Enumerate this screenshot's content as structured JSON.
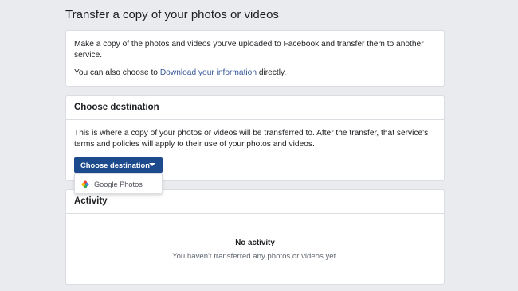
{
  "page": {
    "title": "Transfer a copy of your photos or videos"
  },
  "intro": {
    "description": "Make a copy of the photos and videos you've uploaded to Facebook and transfer them to another service.",
    "also_prefix": "You can also choose to ",
    "download_link": "Download your information",
    "also_suffix": " directly."
  },
  "destination": {
    "heading": "Choose destination",
    "description": "This is where a copy of your photos or videos will be transferred to. After the transfer, that service's terms and policies will apply to their use of your photos and videos.",
    "button_label": "Choose destination",
    "options": [
      {
        "label": "Google Photos",
        "icon": "google-photos-icon"
      }
    ]
  },
  "activity": {
    "heading": "Activity",
    "empty_title": "No activity",
    "empty_subtitle": "You haven't transferred any photos or videos yet."
  },
  "colors": {
    "background": "#e9ebee",
    "button": "#1c4a8c",
    "link": "#385898",
    "border": "#dadde1"
  }
}
